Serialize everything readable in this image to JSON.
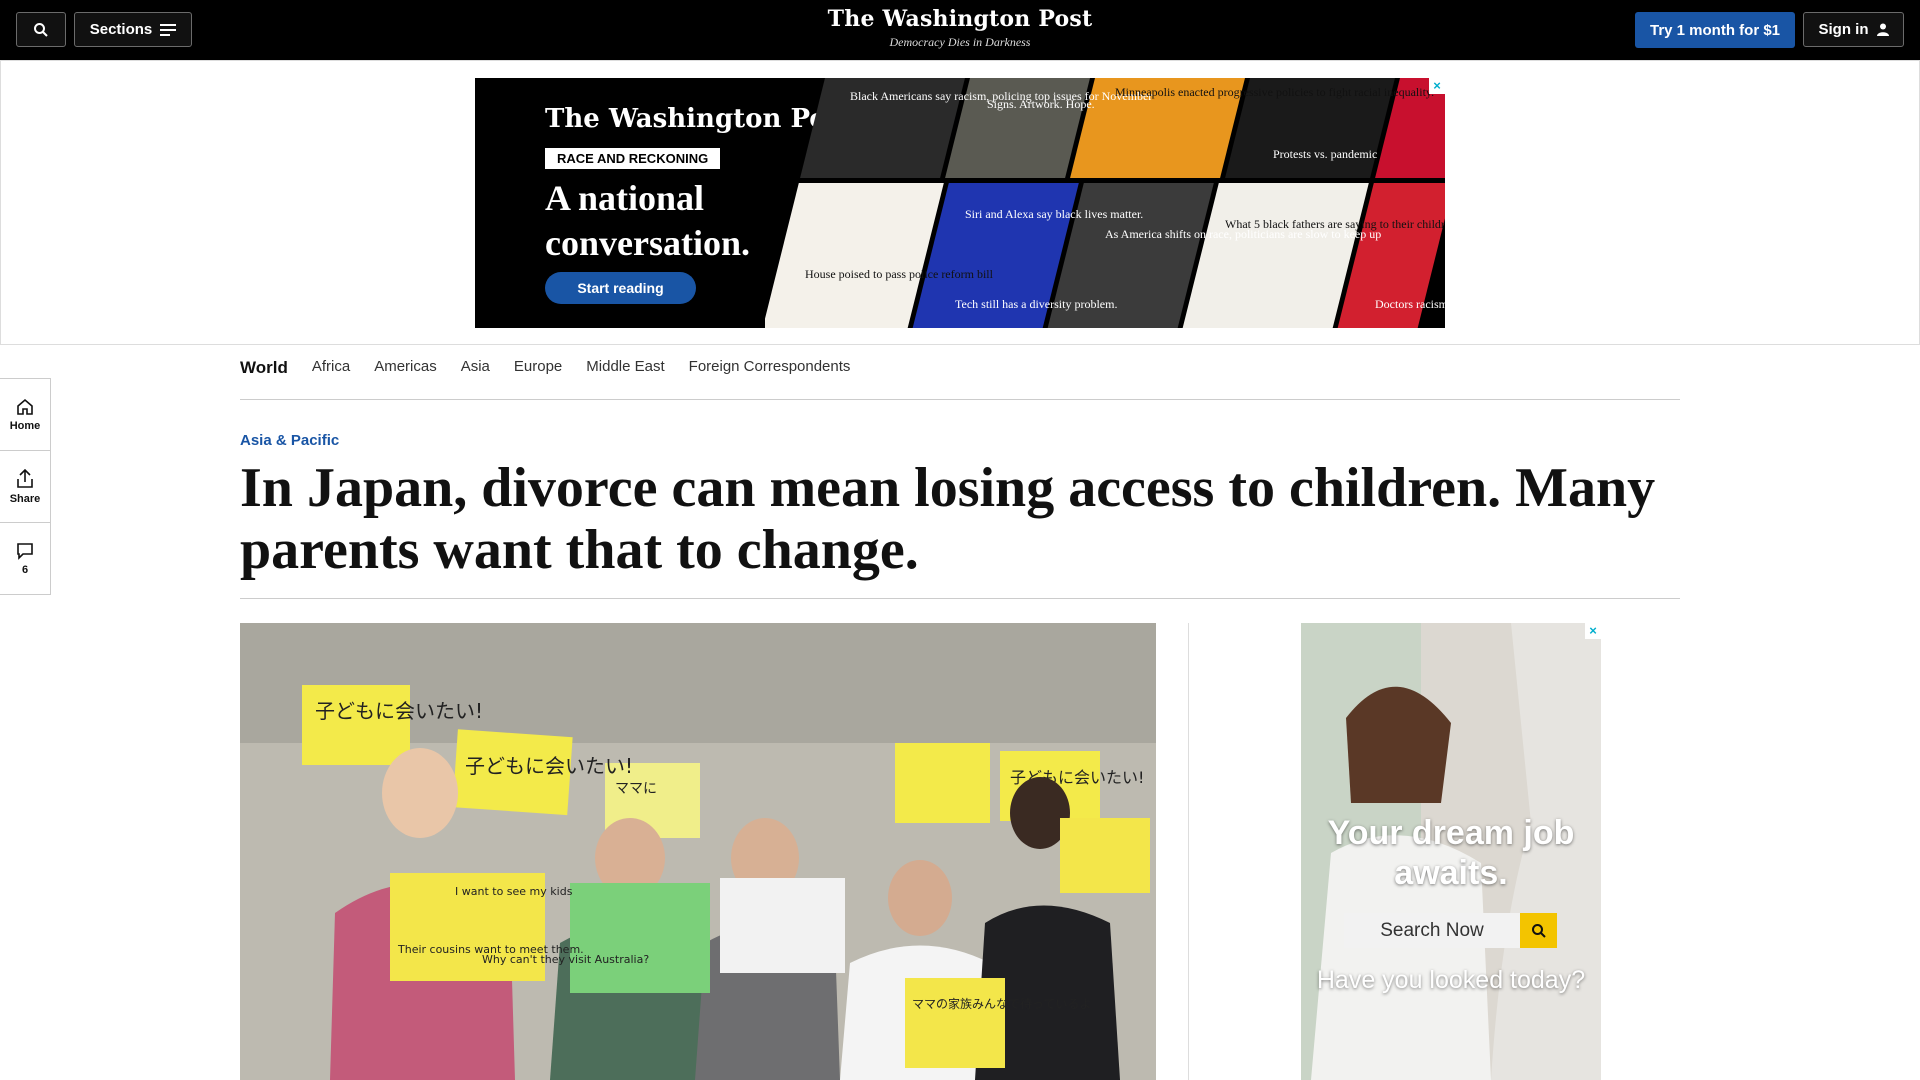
{
  "topbar": {
    "sections_label": "Sections",
    "logo": "The Washington Post",
    "tagline": "Democracy Dies in Darkness",
    "trial_label": "Try 1 month for $1",
    "signin_label": "Sign in"
  },
  "banner_ad": {
    "logo": "The Washington Post",
    "tag": "RACE AND RECKONING",
    "headline": "A national conversation.",
    "cta": "Start reading",
    "close_icon": "×",
    "tiles": [
      "Black Americans say racism, policing top issues for November",
      "Signs. Artwork. Hope.",
      "Minneapolis enacted progressive policies to fight racial inequality.",
      "Protests vs. pandemic",
      "House poised to pass police reform bill",
      "Siri and Alexa say black lives matter.",
      "Tech still has a diversity problem.",
      "As America shifts on race, politicians are slow to keep up",
      "What 5 black fathers are saying to their children",
      "Doctors racism in"
    ]
  },
  "rail": {
    "home_label": "Home",
    "share_label": "Share",
    "comments_count": "6"
  },
  "nav": {
    "section": "World",
    "items": [
      "Africa",
      "Americas",
      "Asia",
      "Europe",
      "Middle East",
      "Foreign Correspondents"
    ]
  },
  "article": {
    "kicker": "Asia & Pacific",
    "headline": "In Japan, divorce can mean losing access to children. Many parents want that to change."
  },
  "photo": {
    "signs": [
      "子どもに会いたい!",
      "子どもに会いたい!",
      "ママに",
      "子どもに会いたい!",
      "ママの家族みんなで待っているよ",
      "I want to see my kids",
      "Their cousins want to meet them.",
      "Why can't they visit Australia?"
    ]
  },
  "side_ad": {
    "headline": "Your dream job awaits.",
    "search_placeholder": "Search Now",
    "cta": "Have you looked today?",
    "close_icon": "×"
  },
  "colors": {
    "brand_blue": "#1955a5",
    "topbar": "#000000",
    "search_yellow": "#f3c400"
  }
}
